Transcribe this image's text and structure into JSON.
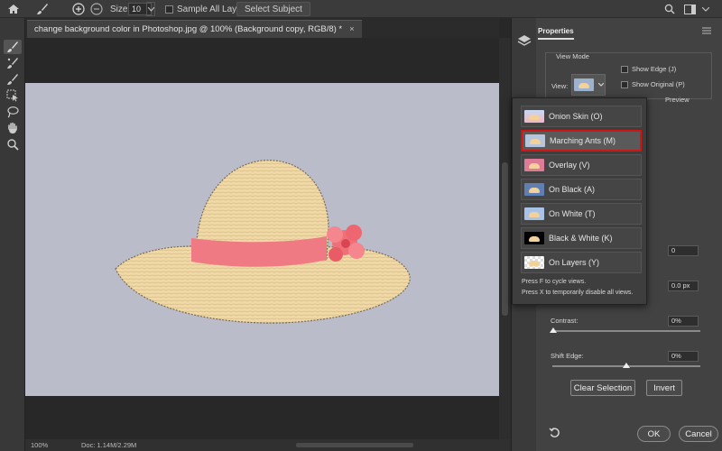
{
  "options_bar": {
    "size_label": "Size:",
    "size_value": "10",
    "sample_all_layers_label": "Sample All Layers",
    "select_subject_label": "Select Subject"
  },
  "document": {
    "tab_title": "change background color in Photoshop.jpg @ 100% (Background copy, RGB/8) *",
    "close_glyph": "×",
    "zoom": "100%",
    "doc_info": "Doc: 1.14M/2.29M"
  },
  "colors": {
    "canvas_bg": "#babdc9",
    "selected_outline": "#d01515",
    "hat_band": "#f07a84",
    "hat_straw": "#f1d9a7"
  },
  "properties": {
    "tab_label": "Properties",
    "view_mode_label": "View Mode",
    "view_label": "View:",
    "show_edge_label": "Show Edge (J)",
    "show_original_label": "Show Original (P)",
    "preview_label": "Preview",
    "radius_value": "0",
    "feather_value": "0.0 px",
    "contrast_label": "Contrast:",
    "contrast_value": "0%",
    "shift_edge_label": "Shift Edge:",
    "shift_edge_value": "0%",
    "clear_selection_label": "Clear Selection",
    "invert_label": "Invert",
    "ok_label": "OK",
    "cancel_label": "Cancel"
  },
  "view_dropdown": {
    "items": [
      {
        "label": "Onion Skin (O)",
        "selected": false
      },
      {
        "label": "Marching Ants (M)",
        "selected": true
      },
      {
        "label": "Overlay (V)",
        "selected": false
      },
      {
        "label": "On Black (A)",
        "selected": false
      },
      {
        "label": "On White (T)",
        "selected": false
      },
      {
        "label": "Black & White (K)",
        "selected": false
      },
      {
        "label": "On Layers (Y)",
        "selected": false
      }
    ],
    "note_cycle": "Press F to cycle views.",
    "note_disable": "Press X to temporarily disable all views."
  }
}
